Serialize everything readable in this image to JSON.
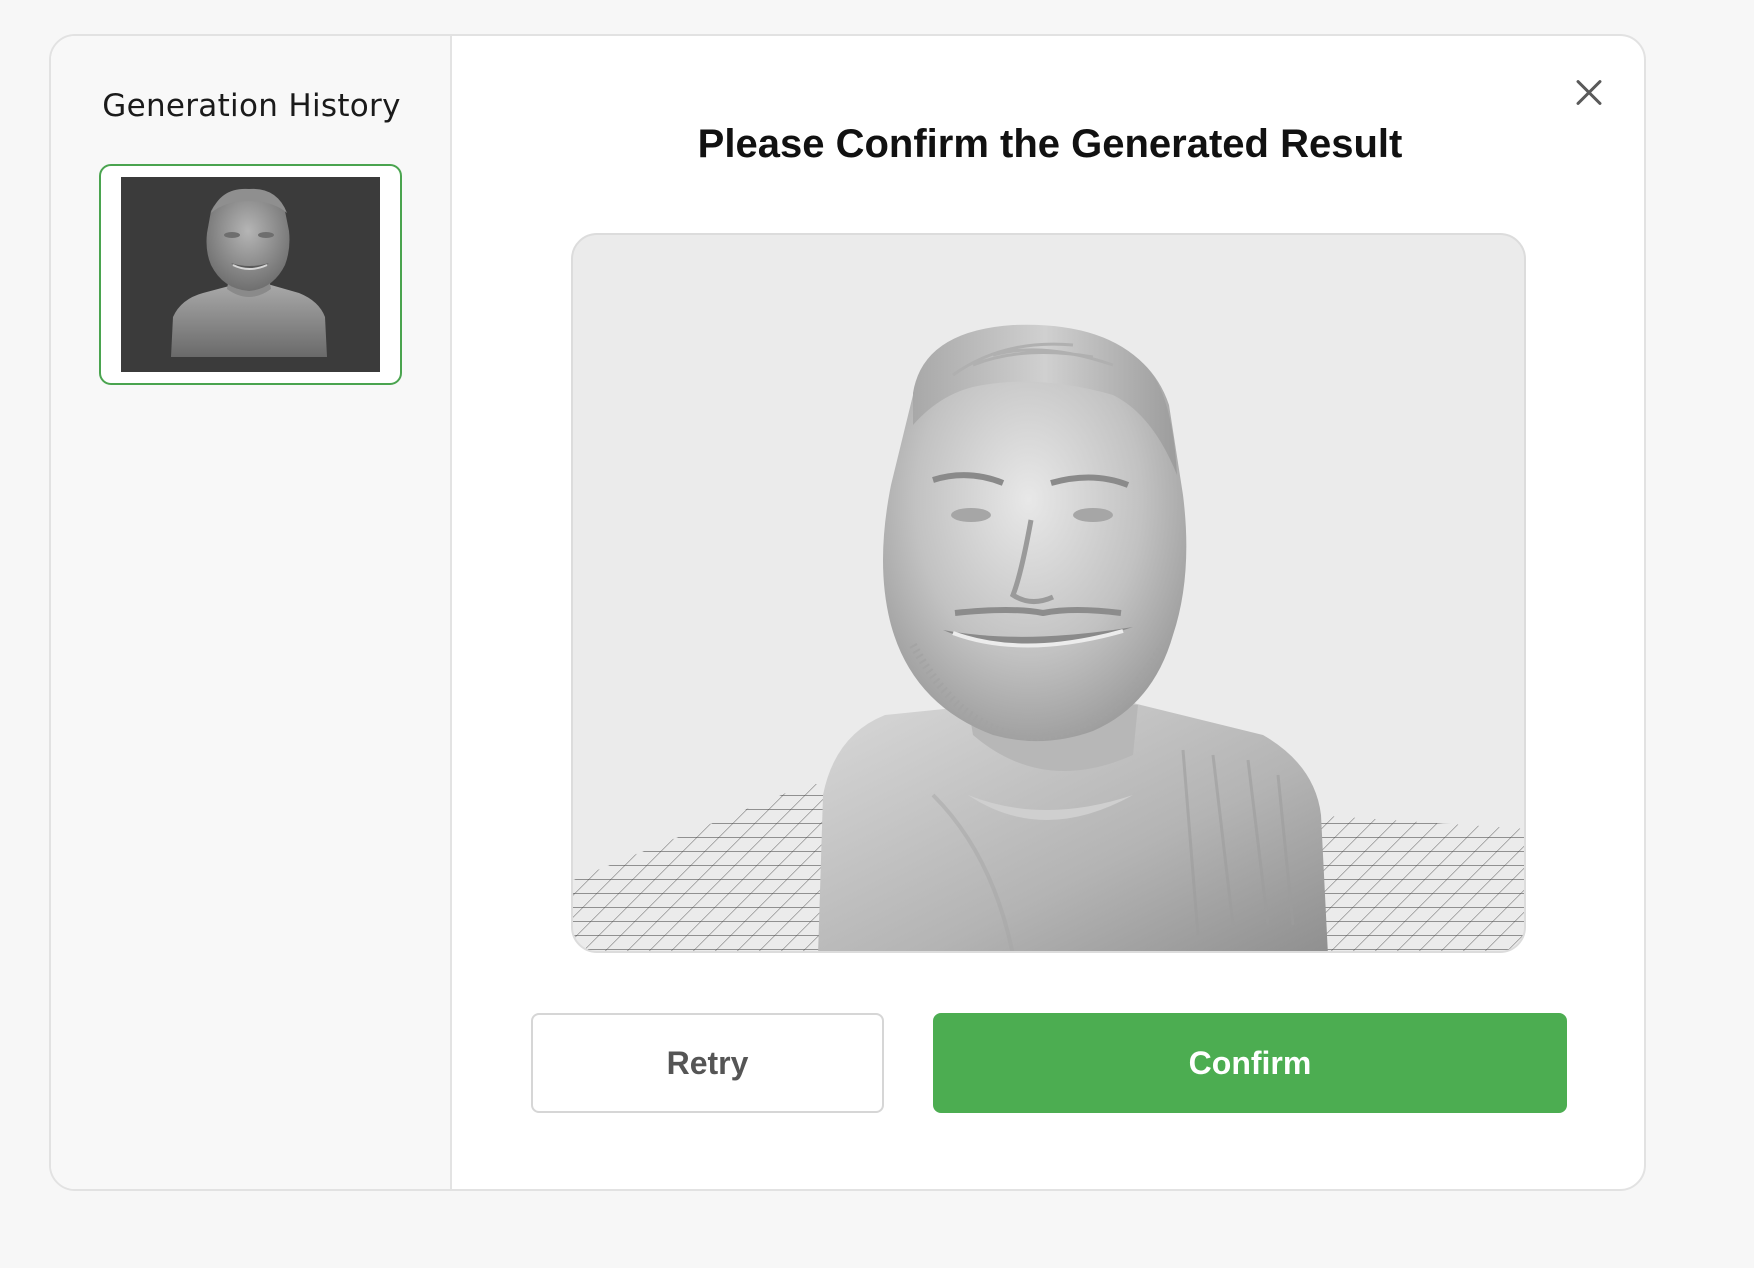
{
  "sidebar": {
    "title": "Generation History",
    "items": [
      {
        "thumbnail": "3d-bust-thumbnail",
        "selected": true
      }
    ]
  },
  "main": {
    "title": "Please Confirm the Generated Result",
    "preview": "3d-bust-model",
    "close_icon": "close-icon"
  },
  "actions": {
    "retry_label": "Retry",
    "confirm_label": "Confirm"
  },
  "colors": {
    "accent": "#4cad51",
    "selected_border": "#4aa44f",
    "preview_bg": "#ebebeb",
    "thumb_bg": "#3b3b3b"
  }
}
